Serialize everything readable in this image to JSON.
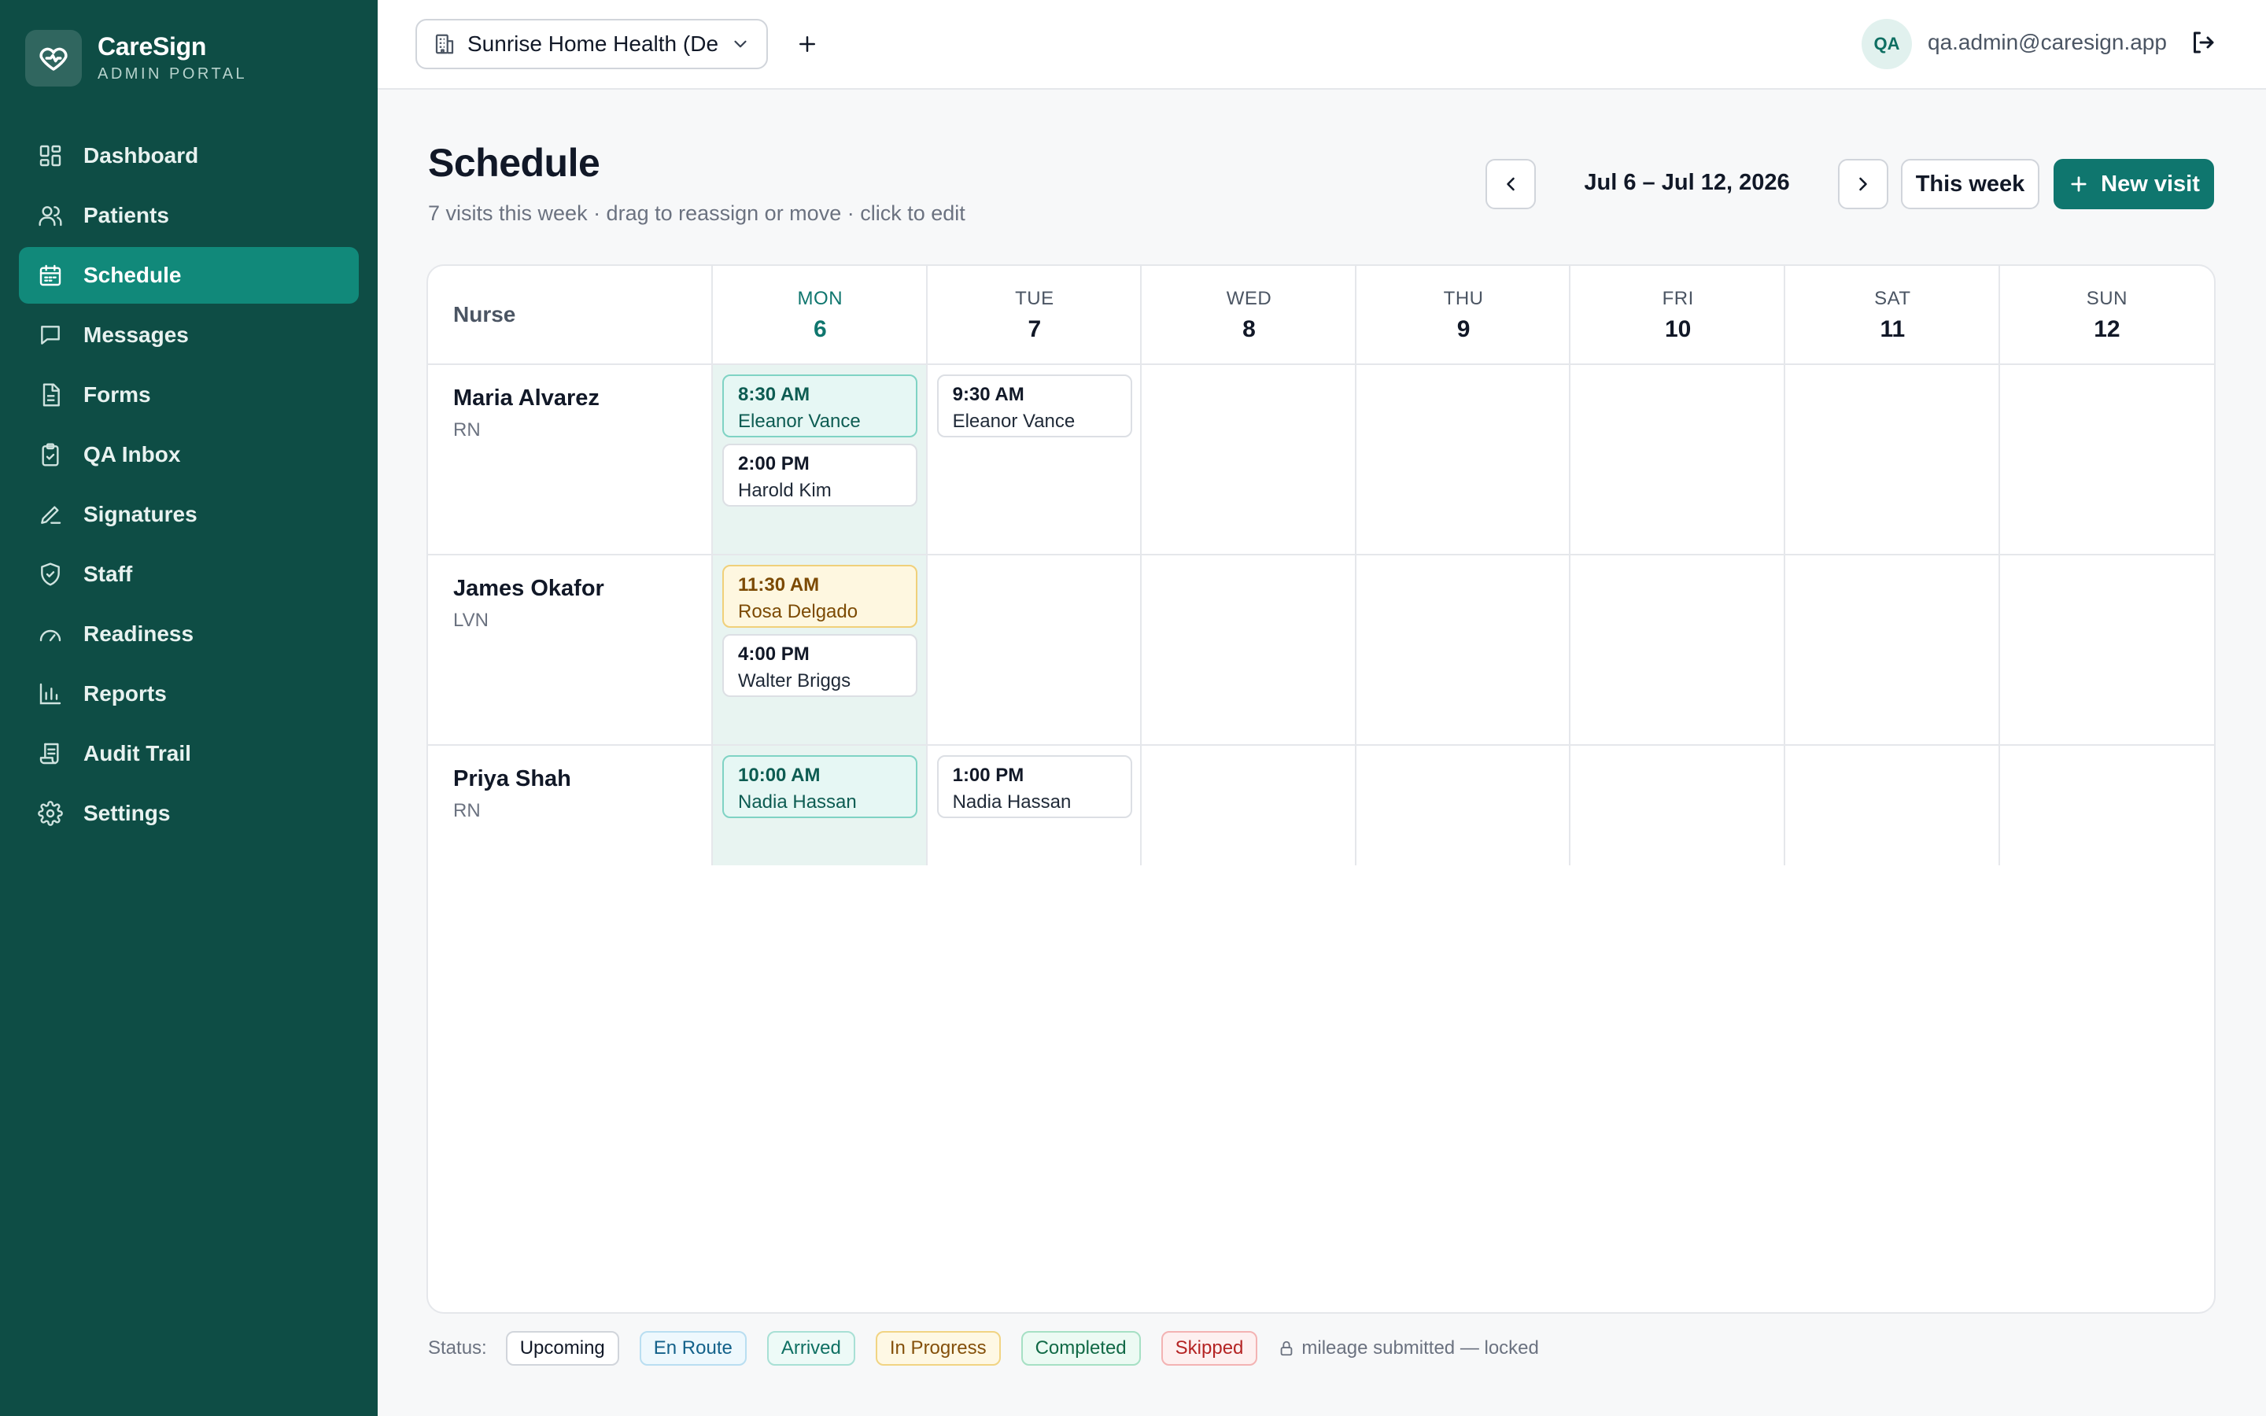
{
  "brand": {
    "name": "CareSign",
    "subtitle": "ADMIN PORTAL"
  },
  "nav": [
    {
      "label": "Dashboard",
      "icon": "dashboard-icon"
    },
    {
      "label": "Patients",
      "icon": "users-icon"
    },
    {
      "label": "Schedule",
      "icon": "calendar-icon",
      "active": true
    },
    {
      "label": "Messages",
      "icon": "message-icon"
    },
    {
      "label": "Forms",
      "icon": "document-icon"
    },
    {
      "label": "QA Inbox",
      "icon": "clipboard-check-icon"
    },
    {
      "label": "Signatures",
      "icon": "pen-icon"
    },
    {
      "label": "Staff",
      "icon": "shield-icon"
    },
    {
      "label": "Readiness",
      "icon": "gauge-icon"
    },
    {
      "label": "Reports",
      "icon": "bar-chart-icon"
    },
    {
      "label": "Audit Trail",
      "icon": "scroll-icon"
    },
    {
      "label": "Settings",
      "icon": "gear-icon"
    }
  ],
  "topbar": {
    "org": "Sunrise Home Health (De",
    "user_initials": "QA",
    "user_email": "qa.admin@caresign.app"
  },
  "header": {
    "title": "Schedule",
    "subtitle": "7 visits this week · drag to reassign or move · click to edit",
    "week_range": "Jul 6 – Jul 12, 2026",
    "this_week": "This week",
    "new_visit": "New visit"
  },
  "grid": {
    "nurse_header": "Nurse",
    "days": [
      {
        "dow": "MON",
        "num": "6",
        "today": true
      },
      {
        "dow": "TUE",
        "num": "7"
      },
      {
        "dow": "WED",
        "num": "8"
      },
      {
        "dow": "THU",
        "num": "9"
      },
      {
        "dow": "FRI",
        "num": "10"
      },
      {
        "dow": "SAT",
        "num": "11"
      },
      {
        "dow": "SUN",
        "num": "12"
      }
    ],
    "nurses": [
      {
        "name": "Maria Alvarez",
        "role": "RN",
        "visits": [
          {
            "day": 0,
            "slot": 0,
            "time": "8:30 AM",
            "patient": "Eleanor Vance",
            "status": "arrived"
          },
          {
            "day": 0,
            "slot": 1,
            "time": "2:00 PM",
            "patient": "Harold Kim",
            "status": "upcoming"
          },
          {
            "day": 1,
            "slot": 0,
            "time": "9:30 AM",
            "patient": "Eleanor Vance",
            "status": "upcoming"
          }
        ]
      },
      {
        "name": "James Okafor",
        "role": "LVN",
        "visits": [
          {
            "day": 0,
            "slot": 0,
            "time": "11:30 AM",
            "patient": "Rosa Delgado",
            "status": "progress"
          },
          {
            "day": 0,
            "slot": 1,
            "time": "4:00 PM",
            "patient": "Walter Briggs",
            "status": "upcoming"
          }
        ]
      },
      {
        "name": "Priya Shah",
        "role": "RN",
        "visits": [
          {
            "day": 0,
            "slot": 0,
            "time": "10:00 AM",
            "patient": "Nadia Hassan",
            "status": "arrived"
          },
          {
            "day": 1,
            "slot": 0,
            "time": "1:00 PM",
            "patient": "Nadia Hassan",
            "status": "upcoming"
          }
        ]
      }
    ]
  },
  "legend": {
    "label": "Status:",
    "chips": [
      {
        "label": "Upcoming",
        "cls": "upcoming"
      },
      {
        "label": "En Route",
        "cls": "enroute"
      },
      {
        "label": "Arrived",
        "cls": "arrived"
      },
      {
        "label": "In Progress",
        "cls": "progress"
      },
      {
        "label": "Completed",
        "cls": "completed"
      },
      {
        "label": "Skipped",
        "cls": "skipped"
      }
    ],
    "lock_note": "mileage submitted — locked"
  }
}
